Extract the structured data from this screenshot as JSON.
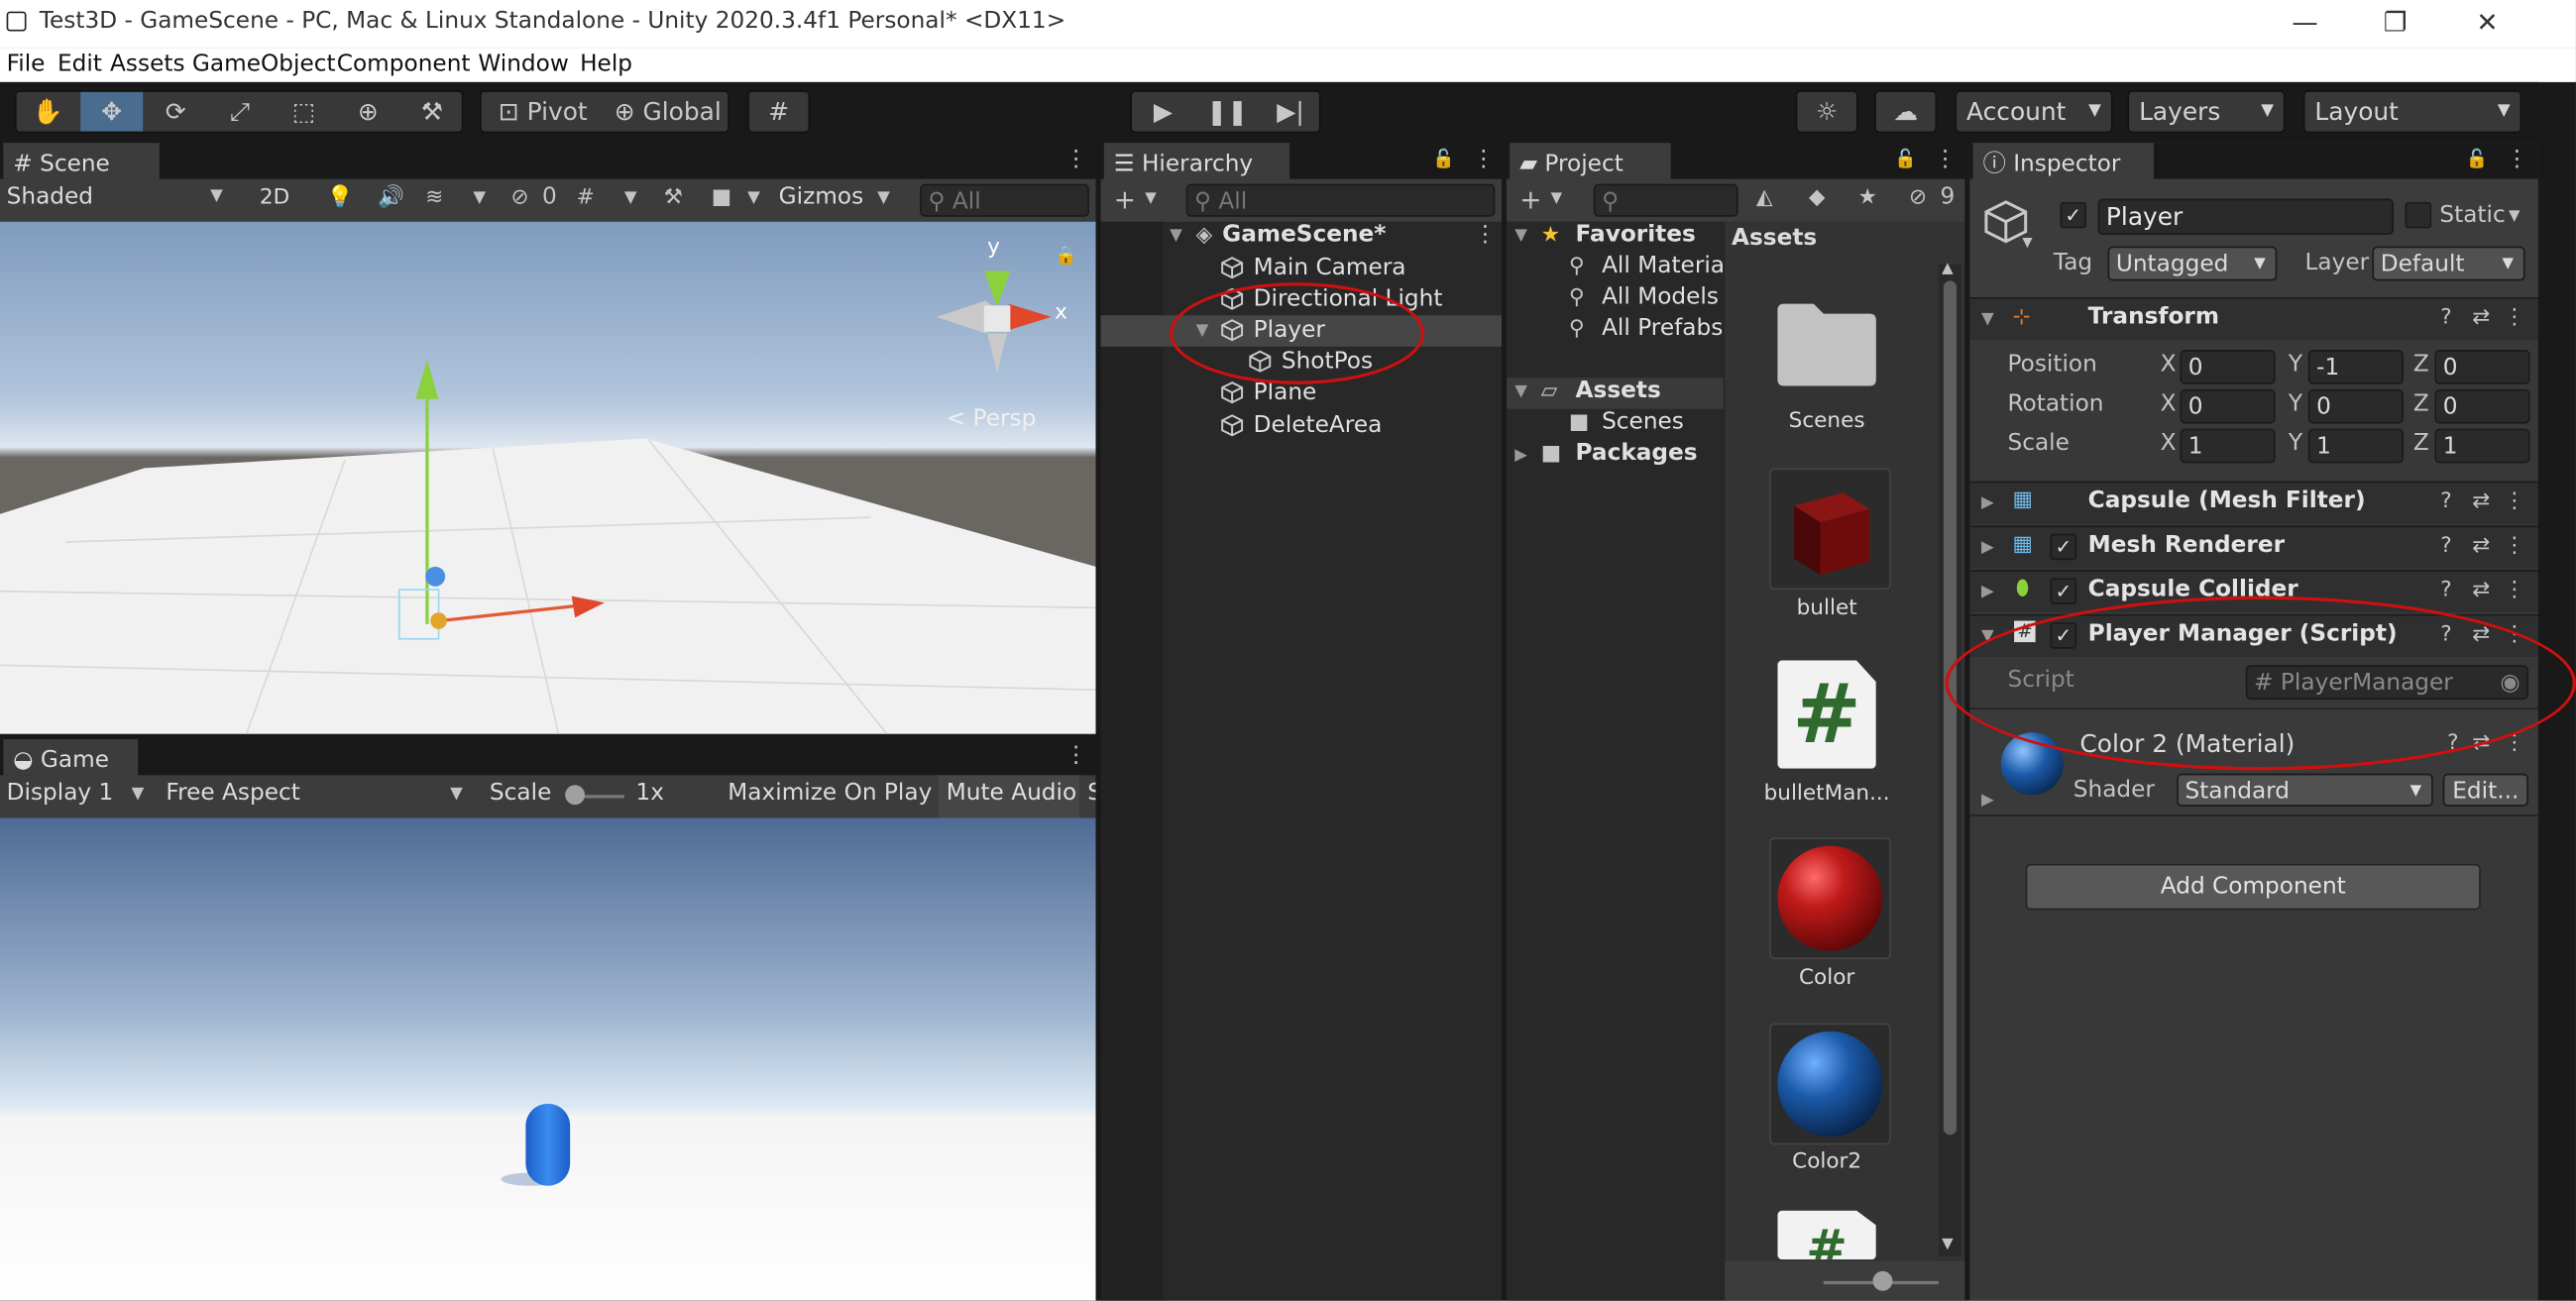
{
  "window": {
    "title": "Test3D - GameScene - PC, Mac & Linux Standalone - Unity 2020.3.4f1 Personal* <DX11>",
    "controls": {
      "minimize": "—",
      "maximize": "❐",
      "close": "✕"
    }
  },
  "menu": [
    "File",
    "Edit",
    "Assets",
    "GameObject",
    "Component",
    "Window",
    "Help"
  ],
  "toolbar": {
    "pivot": "Pivot",
    "global": "Global",
    "account": "Account",
    "layers": "Layers",
    "layout": "Layout"
  },
  "scene": {
    "tab": "Scene",
    "shading": "Shaded",
    "mode_2d": "2D",
    "hidden_count": "0",
    "gizmos": "Gizmos",
    "search_placeholder": "All",
    "axis_y": "y",
    "axis_x": "x",
    "persp": "< Persp"
  },
  "game": {
    "tab": "Game",
    "display": "Display 1",
    "aspect": "Free Aspect",
    "scale_label": "Scale",
    "scale_value": "1x",
    "maximize": "Maximize On Play",
    "mute": "Mute Audio",
    "overflow": "S"
  },
  "hierarchy": {
    "tab": "Hierarchy",
    "search_placeholder": "All",
    "scene_name": "GameScene*",
    "items": [
      "Main Camera",
      "Directional Light",
      "Player",
      "ShotPos",
      "Plane",
      "DeleteArea"
    ]
  },
  "project": {
    "tab": "Project",
    "hidden_count": "9",
    "favorites": "Favorites",
    "favorite_items": [
      "All Materia",
      "All Models",
      "All Prefabs"
    ],
    "assets_folder": "Assets",
    "scenes_folder": "Scenes",
    "packages_folder": "Packages",
    "assets_header": "Assets",
    "tiles": [
      "Scenes",
      "bullet",
      "bulletMan...",
      "Color",
      "Color2"
    ]
  },
  "inspector": {
    "tab": "Inspector",
    "object_name": "Player",
    "static": "Static",
    "tag_label": "Tag",
    "tag_value": "Untagged",
    "layer_label": "Layer",
    "layer_value": "Default",
    "transform": {
      "title": "Transform",
      "position_label": "Position",
      "rotation_label": "Rotation",
      "scale_label": "Scale",
      "axis_x": "X",
      "axis_y": "Y",
      "axis_z": "Z",
      "position": [
        "0",
        "-1",
        "0"
      ],
      "rotation": [
        "0",
        "0",
        "0"
      ],
      "scale": [
        "1",
        "1",
        "1"
      ]
    },
    "components": [
      "Capsule (Mesh Filter)",
      "Mesh Renderer",
      "Capsule Collider",
      "Player Manager (Script)"
    ],
    "script_label": "Script",
    "script_value": "PlayerManager",
    "material_name": "Color 2 (Material)",
    "shader_label": "Shader",
    "shader_value": "Standard",
    "edit_button": "Edit...",
    "add_component": "Add Component"
  },
  "colors": {
    "annotation": "#cc1111",
    "selected_tool": "#4a6c8e",
    "bullet": "#6e0c0c",
    "color_sphere": "#b01818",
    "color2_sphere": "#1b5aa8",
    "player_capsule": "#1a6fdc"
  }
}
